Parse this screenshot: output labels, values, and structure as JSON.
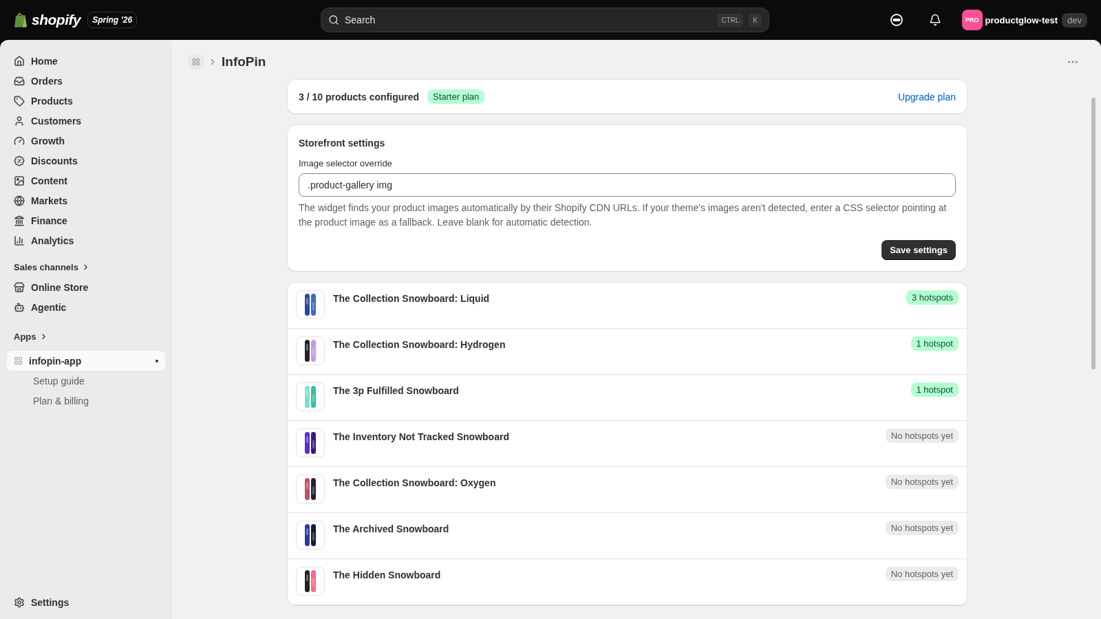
{
  "topbar": {
    "brand": "shopify",
    "edition": "Spring ’26",
    "search": {
      "placeholder": "Search",
      "shortcut": [
        "CTRL",
        "K"
      ]
    },
    "avatar": "PRO",
    "store": "productglow-test",
    "store_tag": "dev"
  },
  "sidebar": {
    "items": [
      "Home",
      "Orders",
      "Products",
      "Customers",
      "Growth",
      "Discounts",
      "Content",
      "Markets",
      "Finance",
      "Analytics"
    ],
    "sales_channels": {
      "heading": "Sales channels",
      "items": [
        "Online Store",
        "Agentic"
      ]
    },
    "apps": {
      "heading": "Apps",
      "items": [
        {
          "label": "infopin-app",
          "selected": true,
          "children": [
            {
              "label": "Setup guide",
              "selected": false
            },
            {
              "label": "Plan & billing",
              "selected": false
            }
          ]
        }
      ]
    },
    "settings": "Settings"
  },
  "page": {
    "title": "InfoPin",
    "usage": {
      "text": "3 / 10 products configured",
      "plan": "Starter plan",
      "link": "Upgrade plan"
    },
    "settings": {
      "title": "Storefront settings",
      "field_label": "Image selector override",
      "value": ".product-gallery img",
      "help": "The widget finds your product images automatically by their Shopify CDN URLs. If your theme's images aren't detected, enter a CSS selector pointing at the product image as a fallback. Leave blank for automatic detection.",
      "button": "Save settings"
    },
    "products": [
      {
        "name": "The Collection Snowboard: Liquid",
        "badge": "3 hotspots",
        "kind": "hotspots"
      },
      {
        "name": "The Collection Snowboard: Hydrogen",
        "badge": "1 hotspot",
        "kind": "hotspots"
      },
      {
        "name": "The 3p Fulfilled Snowboard",
        "badge": "1 hotspot",
        "kind": "hotspots"
      },
      {
        "name": "The Inventory Not Tracked Snowboard",
        "badge": "No hotspots yet",
        "kind": "empty"
      },
      {
        "name": "The Collection Snowboard: Oxygen",
        "badge": "No hotspots yet",
        "kind": "empty"
      },
      {
        "name": "The Archived Snowboard",
        "badge": "No hotspots yet",
        "kind": "empty"
      },
      {
        "name": "The Hidden Snowboard",
        "badge": "No hotspots yet",
        "kind": "empty"
      }
    ]
  }
}
